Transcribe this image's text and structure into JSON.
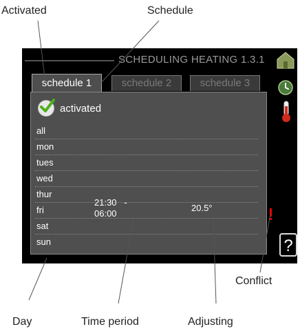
{
  "callouts": {
    "activated": "Activated",
    "schedule": "Schedule",
    "conflict": "Conflict",
    "day": "Day",
    "time_period": "Time period",
    "adjusting": "Adjusting"
  },
  "screen": {
    "title": "SCHEDULING HEATING 1.3.1",
    "tabs": [
      {
        "label": "schedule 1",
        "active": true
      },
      {
        "label": "schedule 2",
        "active": false
      },
      {
        "label": "schedule 3",
        "active": false
      }
    ],
    "activated_label": "activated",
    "days": [
      "all",
      "mon",
      "tues",
      "wed",
      "thur",
      "fri",
      "sat",
      "sun"
    ],
    "entry": {
      "time_line1": "21:30   -",
      "time_line2": "06:00",
      "temperature": "20.5°"
    },
    "help_label": "?"
  },
  "icons": [
    "house-icon",
    "clock-icon",
    "thermometer-icon",
    "check-icon",
    "conflict-icon",
    "help-icon"
  ],
  "colors": {
    "screen_bg": "#000000",
    "panel_bg": "#4f4f4f",
    "conflict": "#e00000"
  }
}
